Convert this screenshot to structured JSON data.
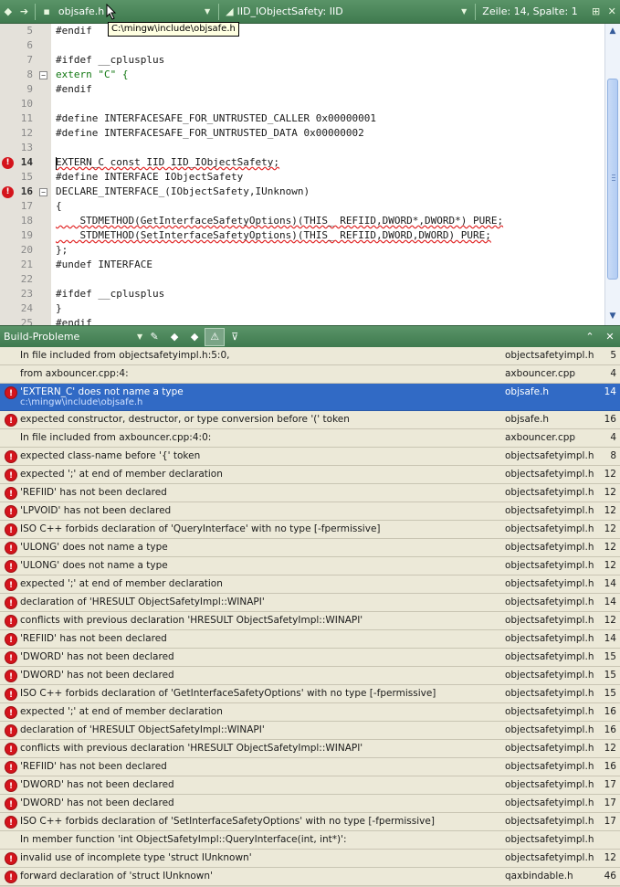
{
  "toolbar": {
    "file": "objsafe.h",
    "symbol": "IID_IObjectSafety: IID",
    "position": "Zeile: 14, Spalte: 1",
    "tooltip": "C:\\mingw\\include\\objsafe.h"
  },
  "editor": {
    "lines": [
      {
        "n": "5",
        "code": "#endif"
      },
      {
        "n": "6",
        "code": ""
      },
      {
        "n": "7",
        "code": "#ifdef __cplusplus"
      },
      {
        "n": "8",
        "code": "extern \"C\" {"
      },
      {
        "n": "9",
        "code": "#endif"
      },
      {
        "n": "10",
        "code": ""
      },
      {
        "n": "11",
        "code": "#define INTERFACESAFE_FOR_UNTRUSTED_CALLER 0x00000001"
      },
      {
        "n": "12",
        "code": "#define INTERFACESAFE_FOR_UNTRUSTED_DATA 0x00000002"
      },
      {
        "n": "13",
        "code": ""
      },
      {
        "n": "14",
        "code": "EXTERN_C const IID IID_IObjectSafety;"
      },
      {
        "n": "15",
        "code": "#define INTERFACE IObjectSafety"
      },
      {
        "n": "16",
        "code": "DECLARE_INTERFACE_(IObjectSafety,IUnknown)"
      },
      {
        "n": "17",
        "code": "{"
      },
      {
        "n": "18",
        "code": "    STDMETHOD(GetInterfaceSafetyOptions)(THIS_ REFIID,DWORD*,DWORD*) PURE;"
      },
      {
        "n": "19",
        "code": "    STDMETHOD(SetInterfaceSafetyOptions)(THIS_ REFIID,DWORD,DWORD) PURE;"
      },
      {
        "n": "20",
        "code": "};"
      },
      {
        "n": "21",
        "code": "#undef INTERFACE"
      },
      {
        "n": "22",
        "code": ""
      },
      {
        "n": "23",
        "code": "#ifdef __cplusplus"
      },
      {
        "n": "24",
        "code": "}"
      },
      {
        "n": "25",
        "code": "#endif"
      }
    ]
  },
  "panel": {
    "title": "Build-Probleme"
  },
  "problems": [
    {
      "msg": "In file included from objectsafetyimpl.h:5:0,",
      "file": "objectsafetyimpl.h",
      "line": "5",
      "error": false
    },
    {
      "msg": "from axbouncer.cpp:4:",
      "file": "axbouncer.cpp",
      "line": "4",
      "error": false
    },
    {
      "msg": "'EXTERN_C' does not name a type",
      "sub": "c:\\mingw\\include\\objsafe.h",
      "file": "objsafe.h",
      "line": "14",
      "error": true,
      "selected": true
    },
    {
      "msg": "expected constructor, destructor, or type conversion before '(' token",
      "file": "objsafe.h",
      "line": "16",
      "error": true
    },
    {
      "msg": "In file included from axbouncer.cpp:4:0:",
      "file": "axbouncer.cpp",
      "line": "4",
      "error": false
    },
    {
      "msg": "expected class-name before '{' token",
      "file": "objectsafetyimpl.h",
      "line": "8",
      "error": true
    },
    {
      "msg": "expected ';' at end of member declaration",
      "file": "objectsafetyimpl.h",
      "line": "12",
      "error": true
    },
    {
      "msg": "'REFIID' has not been declared",
      "file": "objectsafetyimpl.h",
      "line": "12",
      "error": true
    },
    {
      "msg": "'LPVOID' has not been declared",
      "file": "objectsafetyimpl.h",
      "line": "12",
      "error": true
    },
    {
      "msg": "ISO C++ forbids declaration of 'QueryInterface' with no type [-fpermissive]",
      "file": "objectsafetyimpl.h",
      "line": "12",
      "error": true
    },
    {
      "msg": "'ULONG' does not name a type",
      "file": "objectsafetyimpl.h",
      "line": "12",
      "error": true
    },
    {
      "msg": "'ULONG' does not name a type",
      "file": "objectsafetyimpl.h",
      "line": "12",
      "error": true
    },
    {
      "msg": "expected ';' at end of member declaration",
      "file": "objectsafetyimpl.h",
      "line": "14",
      "error": true
    },
    {
      "msg": "declaration of 'HRESULT ObjectSafetyImpl::WINAPI'",
      "file": "objectsafetyimpl.h",
      "line": "14",
      "error": true
    },
    {
      "msg": "conflicts with previous declaration 'HRESULT ObjectSafetyImpl::WINAPI'",
      "file": "objectsafetyimpl.h",
      "line": "12",
      "error": true
    },
    {
      "msg": "'REFIID' has not been declared",
      "file": "objectsafetyimpl.h",
      "line": "14",
      "error": true
    },
    {
      "msg": "'DWORD' has not been declared",
      "file": "objectsafetyimpl.h",
      "line": "15",
      "error": true
    },
    {
      "msg": "'DWORD' has not been declared",
      "file": "objectsafetyimpl.h",
      "line": "15",
      "error": true
    },
    {
      "msg": "ISO C++ forbids declaration of 'GetInterfaceSafetyOptions' with no type [-fpermissive]",
      "file": "objectsafetyimpl.h",
      "line": "15",
      "error": true
    },
    {
      "msg": "expected ';' at end of member declaration",
      "file": "objectsafetyimpl.h",
      "line": "16",
      "error": true
    },
    {
      "msg": "declaration of 'HRESULT ObjectSafetyImpl::WINAPI'",
      "file": "objectsafetyimpl.h",
      "line": "16",
      "error": true
    },
    {
      "msg": "conflicts with previous declaration 'HRESULT ObjectSafetyImpl::WINAPI'",
      "file": "objectsafetyimpl.h",
      "line": "12",
      "error": true
    },
    {
      "msg": "'REFIID' has not been declared",
      "file": "objectsafetyimpl.h",
      "line": "16",
      "error": true
    },
    {
      "msg": "'DWORD' has not been declared",
      "file": "objectsafetyimpl.h",
      "line": "17",
      "error": true
    },
    {
      "msg": "'DWORD' has not been declared",
      "file": "objectsafetyimpl.h",
      "line": "17",
      "error": true
    },
    {
      "msg": "ISO C++ forbids declaration of 'SetInterfaceSafetyOptions' with no type [-fpermissive]",
      "file": "objectsafetyimpl.h",
      "line": "17",
      "error": true
    },
    {
      "msg": "In member function 'int ObjectSafetyImpl::QueryInterface(int, int*)':",
      "file": "objectsafetyimpl.h",
      "line": "",
      "error": false
    },
    {
      "msg": "invalid use of incomplete type 'struct IUnknown'",
      "file": "objectsafetyimpl.h",
      "line": "12",
      "error": true
    },
    {
      "msg": "forward declaration of 'struct IUnknown'",
      "file": "qaxbindable.h",
      "line": "46",
      "error": true
    }
  ],
  "colors": {
    "toolbar": "#4a8a5a",
    "selection": "#316ac5",
    "error": "#d4141c"
  }
}
